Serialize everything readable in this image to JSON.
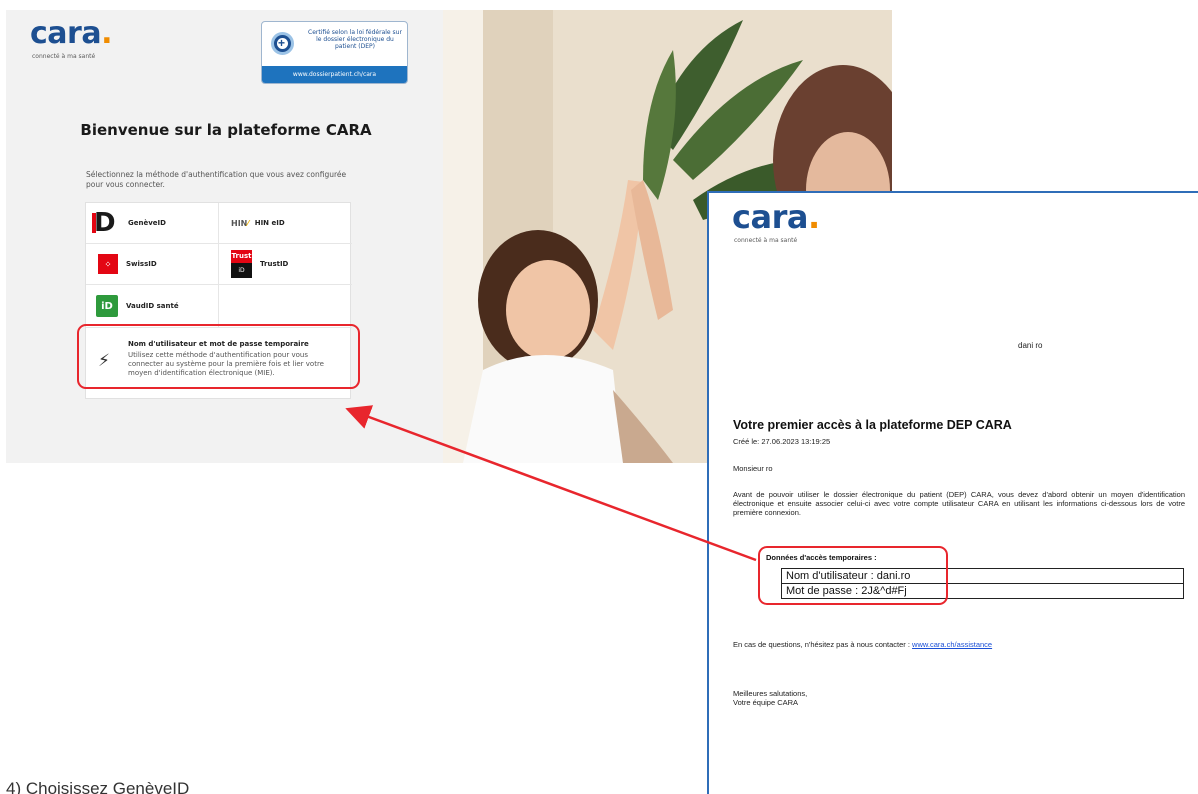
{
  "login": {
    "logo_text": "cara",
    "logo_dot": ".",
    "tagline": "connecté à ma santé",
    "certificate": {
      "text": "Certifié selon la loi fédérale sur le dossier électronique du patient (DEP)",
      "link": "www.dossierpatient.ch/cara"
    },
    "title": "Bienvenue sur la plateforme CARA",
    "subtitle": "Sélectionnez la méthode d'authentification que vous avez configurée pour vous connecter.",
    "methods": {
      "geneveid": {
        "label": "GenèveID",
        "icon": "geneveid-icon",
        "icon_text": "D"
      },
      "hin": {
        "label": "HIN eID",
        "icon": "hin-icon",
        "icon_text": "HIN"
      },
      "swissid": {
        "label": "SwissID",
        "icon": "swissid-icon"
      },
      "trustid": {
        "label": "TrustID",
        "icon": "trustid-icon",
        "icon_top": "Trust",
        "icon_bottom": "iD"
      },
      "vaudid": {
        "label": "VaudID santé",
        "icon": "vaudid-icon",
        "icon_text": "iD"
      },
      "temporary": {
        "title": "Nom d'utilisateur et mot de passe temporaire",
        "description": "Utilisez cette méthode d'authentification pour vous connecter au système pour la première fois et lier votre moyen d'identification électronique (MIE).",
        "icon": "plug-icon"
      }
    }
  },
  "letter": {
    "logo_text": "cara",
    "logo_dot": ".",
    "tagline": "connecté à ma santé",
    "addressee": "dani ro",
    "title": "Votre premier accès à la plateforme DEP CARA",
    "created": "Créé le: 27.06.2023 13:19:25",
    "greeting": "Monsieur ro",
    "intro": "Avant de pouvoir utiliser le dossier électronique du patient (DEP) CARA, vous devez d'abord obtenir un moyen d'identification électronique et ensuite associer celui-ci avec votre compte utilisateur CARA en utilisant les informations ci-dessous lors de votre première connexion.",
    "access_label": "Données d'accès temporaires :",
    "username_row": "Nom d'utilisateur : dani.ro",
    "password_row": "Mot de passe : 2J&^d#Fj",
    "contact_text": "En cas de questions, n'hésitez pas à nous contacter : ",
    "contact_link": "www.cara.ch/assistance",
    "closing_1": "Meilleures salutations,",
    "closing_2": "Votre équipe CARA"
  },
  "caption": "4)  Choisissez GenèveID",
  "colors": {
    "brand_blue": "#1d4f91",
    "brand_orange": "#f08c00",
    "highlight_red": "#e8262d",
    "letter_border": "#2f6db8"
  }
}
